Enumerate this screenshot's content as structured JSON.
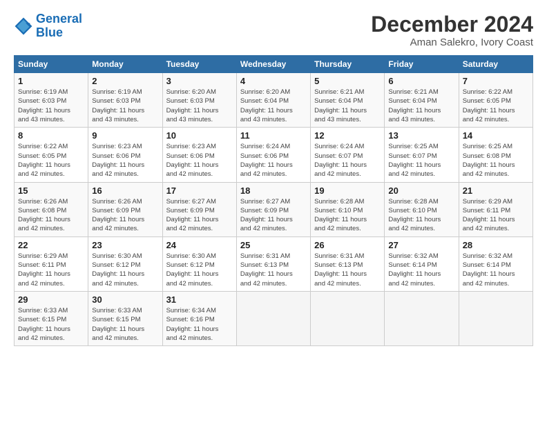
{
  "logo": {
    "line1": "General",
    "line2": "Blue"
  },
  "title": "December 2024",
  "subtitle": "Aman Salekro, Ivory Coast",
  "days_header": [
    "Sunday",
    "Monday",
    "Tuesday",
    "Wednesday",
    "Thursday",
    "Friday",
    "Saturday"
  ],
  "weeks": [
    [
      {
        "day": "1",
        "info": "Sunrise: 6:19 AM\nSunset: 6:03 PM\nDaylight: 11 hours\nand 43 minutes."
      },
      {
        "day": "2",
        "info": "Sunrise: 6:19 AM\nSunset: 6:03 PM\nDaylight: 11 hours\nand 43 minutes."
      },
      {
        "day": "3",
        "info": "Sunrise: 6:20 AM\nSunset: 6:03 PM\nDaylight: 11 hours\nand 43 minutes."
      },
      {
        "day": "4",
        "info": "Sunrise: 6:20 AM\nSunset: 6:04 PM\nDaylight: 11 hours\nand 43 minutes."
      },
      {
        "day": "5",
        "info": "Sunrise: 6:21 AM\nSunset: 6:04 PM\nDaylight: 11 hours\nand 43 minutes."
      },
      {
        "day": "6",
        "info": "Sunrise: 6:21 AM\nSunset: 6:04 PM\nDaylight: 11 hours\nand 43 minutes."
      },
      {
        "day": "7",
        "info": "Sunrise: 6:22 AM\nSunset: 6:05 PM\nDaylight: 11 hours\nand 42 minutes."
      }
    ],
    [
      {
        "day": "8",
        "info": "Sunrise: 6:22 AM\nSunset: 6:05 PM\nDaylight: 11 hours\nand 42 minutes."
      },
      {
        "day": "9",
        "info": "Sunrise: 6:23 AM\nSunset: 6:06 PM\nDaylight: 11 hours\nand 42 minutes."
      },
      {
        "day": "10",
        "info": "Sunrise: 6:23 AM\nSunset: 6:06 PM\nDaylight: 11 hours\nand 42 minutes."
      },
      {
        "day": "11",
        "info": "Sunrise: 6:24 AM\nSunset: 6:06 PM\nDaylight: 11 hours\nand 42 minutes."
      },
      {
        "day": "12",
        "info": "Sunrise: 6:24 AM\nSunset: 6:07 PM\nDaylight: 11 hours\nand 42 minutes."
      },
      {
        "day": "13",
        "info": "Sunrise: 6:25 AM\nSunset: 6:07 PM\nDaylight: 11 hours\nand 42 minutes."
      },
      {
        "day": "14",
        "info": "Sunrise: 6:25 AM\nSunset: 6:08 PM\nDaylight: 11 hours\nand 42 minutes."
      }
    ],
    [
      {
        "day": "15",
        "info": "Sunrise: 6:26 AM\nSunset: 6:08 PM\nDaylight: 11 hours\nand 42 minutes."
      },
      {
        "day": "16",
        "info": "Sunrise: 6:26 AM\nSunset: 6:09 PM\nDaylight: 11 hours\nand 42 minutes."
      },
      {
        "day": "17",
        "info": "Sunrise: 6:27 AM\nSunset: 6:09 PM\nDaylight: 11 hours\nand 42 minutes."
      },
      {
        "day": "18",
        "info": "Sunrise: 6:27 AM\nSunset: 6:09 PM\nDaylight: 11 hours\nand 42 minutes."
      },
      {
        "day": "19",
        "info": "Sunrise: 6:28 AM\nSunset: 6:10 PM\nDaylight: 11 hours\nand 42 minutes."
      },
      {
        "day": "20",
        "info": "Sunrise: 6:28 AM\nSunset: 6:10 PM\nDaylight: 11 hours\nand 42 minutes."
      },
      {
        "day": "21",
        "info": "Sunrise: 6:29 AM\nSunset: 6:11 PM\nDaylight: 11 hours\nand 42 minutes."
      }
    ],
    [
      {
        "day": "22",
        "info": "Sunrise: 6:29 AM\nSunset: 6:11 PM\nDaylight: 11 hours\nand 42 minutes."
      },
      {
        "day": "23",
        "info": "Sunrise: 6:30 AM\nSunset: 6:12 PM\nDaylight: 11 hours\nand 42 minutes."
      },
      {
        "day": "24",
        "info": "Sunrise: 6:30 AM\nSunset: 6:12 PM\nDaylight: 11 hours\nand 42 minutes."
      },
      {
        "day": "25",
        "info": "Sunrise: 6:31 AM\nSunset: 6:13 PM\nDaylight: 11 hours\nand 42 minutes."
      },
      {
        "day": "26",
        "info": "Sunrise: 6:31 AM\nSunset: 6:13 PM\nDaylight: 11 hours\nand 42 minutes."
      },
      {
        "day": "27",
        "info": "Sunrise: 6:32 AM\nSunset: 6:14 PM\nDaylight: 11 hours\nand 42 minutes."
      },
      {
        "day": "28",
        "info": "Sunrise: 6:32 AM\nSunset: 6:14 PM\nDaylight: 11 hours\nand 42 minutes."
      }
    ],
    [
      {
        "day": "29",
        "info": "Sunrise: 6:33 AM\nSunset: 6:15 PM\nDaylight: 11 hours\nand 42 minutes."
      },
      {
        "day": "30",
        "info": "Sunrise: 6:33 AM\nSunset: 6:15 PM\nDaylight: 11 hours\nand 42 minutes."
      },
      {
        "day": "31",
        "info": "Sunrise: 6:34 AM\nSunset: 6:16 PM\nDaylight: 11 hours\nand 42 minutes."
      },
      {
        "day": "",
        "info": ""
      },
      {
        "day": "",
        "info": ""
      },
      {
        "day": "",
        "info": ""
      },
      {
        "day": "",
        "info": ""
      }
    ]
  ]
}
